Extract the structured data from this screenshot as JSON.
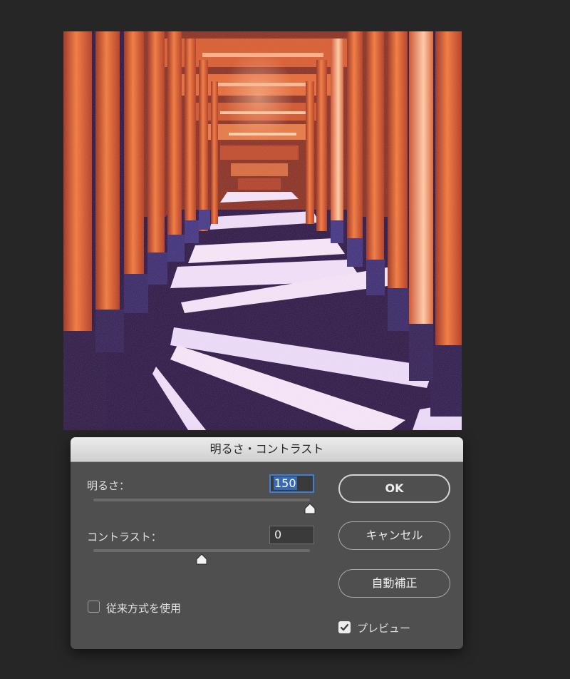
{
  "dialog": {
    "title": "明るさ・コントラスト",
    "brightness": {
      "label": "明るさ：",
      "value": "150",
      "slider_fraction": 1.0
    },
    "contrast": {
      "label": "コントラスト：",
      "value": "0",
      "slider_fraction": 0.5
    },
    "buttons": {
      "ok": "OK",
      "cancel": "キャンセル",
      "auto": "自動補正"
    },
    "legacy_checkbox": {
      "label": "従来方式を使用",
      "checked": false
    },
    "preview_checkbox": {
      "label": "プレビュー",
      "checked": true
    }
  },
  "colors": {
    "background": "#262626",
    "dialog": "#4f4f4f",
    "accent": "#3d7edb",
    "torii_orange": "#d7561a"
  }
}
